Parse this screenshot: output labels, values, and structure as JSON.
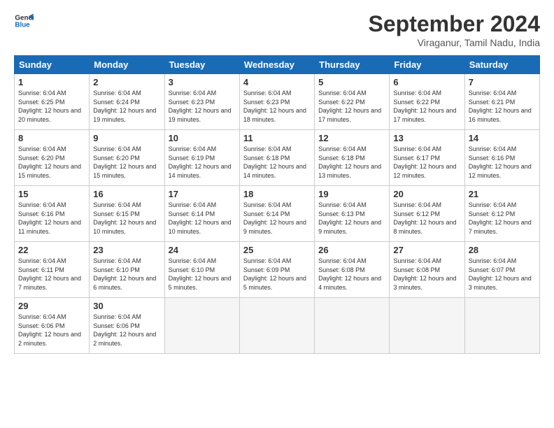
{
  "logo": {
    "line1": "General",
    "line2": "Blue"
  },
  "title": "September 2024",
  "subtitle": "Viraganur, Tamil Nadu, India",
  "days": [
    "Sunday",
    "Monday",
    "Tuesday",
    "Wednesday",
    "Thursday",
    "Friday",
    "Saturday"
  ],
  "cells": [
    {
      "day": "",
      "empty": true
    },
    {
      "day": "",
      "empty": true
    },
    {
      "day": "",
      "empty": true
    },
    {
      "day": "",
      "empty": true
    },
    {
      "day": "",
      "empty": true
    },
    {
      "day": "",
      "empty": true
    },
    {
      "day": "",
      "empty": true
    },
    {
      "num": "1",
      "rise": "6:04 AM",
      "set": "6:25 PM",
      "daylight": "12 hours and 20 minutes."
    },
    {
      "num": "2",
      "rise": "6:04 AM",
      "set": "6:24 PM",
      "daylight": "12 hours and 19 minutes."
    },
    {
      "num": "3",
      "rise": "6:04 AM",
      "set": "6:23 PM",
      "daylight": "12 hours and 19 minutes."
    },
    {
      "num": "4",
      "rise": "6:04 AM",
      "set": "6:23 PM",
      "daylight": "12 hours and 18 minutes."
    },
    {
      "num": "5",
      "rise": "6:04 AM",
      "set": "6:22 PM",
      "daylight": "12 hours and 17 minutes."
    },
    {
      "num": "6",
      "rise": "6:04 AM",
      "set": "6:22 PM",
      "daylight": "12 hours and 17 minutes."
    },
    {
      "num": "7",
      "rise": "6:04 AM",
      "set": "6:21 PM",
      "daylight": "12 hours and 16 minutes."
    },
    {
      "num": "8",
      "rise": "6:04 AM",
      "set": "6:20 PM",
      "daylight": "12 hours and 15 minutes."
    },
    {
      "num": "9",
      "rise": "6:04 AM",
      "set": "6:20 PM",
      "daylight": "12 hours and 15 minutes."
    },
    {
      "num": "10",
      "rise": "6:04 AM",
      "set": "6:19 PM",
      "daylight": "12 hours and 14 minutes."
    },
    {
      "num": "11",
      "rise": "6:04 AM",
      "set": "6:18 PM",
      "daylight": "12 hours and 14 minutes."
    },
    {
      "num": "12",
      "rise": "6:04 AM",
      "set": "6:18 PM",
      "daylight": "12 hours and 13 minutes."
    },
    {
      "num": "13",
      "rise": "6:04 AM",
      "set": "6:17 PM",
      "daylight": "12 hours and 12 minutes."
    },
    {
      "num": "14",
      "rise": "6:04 AM",
      "set": "6:16 PM",
      "daylight": "12 hours and 12 minutes."
    },
    {
      "num": "15",
      "rise": "6:04 AM",
      "set": "6:16 PM",
      "daylight": "12 hours and 11 minutes."
    },
    {
      "num": "16",
      "rise": "6:04 AM",
      "set": "6:15 PM",
      "daylight": "12 hours and 10 minutes."
    },
    {
      "num": "17",
      "rise": "6:04 AM",
      "set": "6:14 PM",
      "daylight": "12 hours and 10 minutes."
    },
    {
      "num": "18",
      "rise": "6:04 AM",
      "set": "6:14 PM",
      "daylight": "12 hours and 9 minutes."
    },
    {
      "num": "19",
      "rise": "6:04 AM",
      "set": "6:13 PM",
      "daylight": "12 hours and 9 minutes."
    },
    {
      "num": "20",
      "rise": "6:04 AM",
      "set": "6:12 PM",
      "daylight": "12 hours and 8 minutes."
    },
    {
      "num": "21",
      "rise": "6:04 AM",
      "set": "6:12 PM",
      "daylight": "12 hours and 7 minutes."
    },
    {
      "num": "22",
      "rise": "6:04 AM",
      "set": "6:11 PM",
      "daylight": "12 hours and 7 minutes."
    },
    {
      "num": "23",
      "rise": "6:04 AM",
      "set": "6:10 PM",
      "daylight": "12 hours and 6 minutes."
    },
    {
      "num": "24",
      "rise": "6:04 AM",
      "set": "6:10 PM",
      "daylight": "12 hours and 5 minutes."
    },
    {
      "num": "25",
      "rise": "6:04 AM",
      "set": "6:09 PM",
      "daylight": "12 hours and 5 minutes."
    },
    {
      "num": "26",
      "rise": "6:04 AM",
      "set": "6:08 PM",
      "daylight": "12 hours and 4 minutes."
    },
    {
      "num": "27",
      "rise": "6:04 AM",
      "set": "6:08 PM",
      "daylight": "12 hours and 3 minutes."
    },
    {
      "num": "28",
      "rise": "6:04 AM",
      "set": "6:07 PM",
      "daylight": "12 hours and 3 minutes."
    },
    {
      "num": "29",
      "rise": "6:04 AM",
      "set": "6:06 PM",
      "daylight": "12 hours and 2 minutes."
    },
    {
      "num": "30",
      "rise": "6:04 AM",
      "set": "6:06 PM",
      "daylight": "12 hours and 2 minutes."
    },
    {
      "day": "",
      "empty": true
    },
    {
      "day": "",
      "empty": true
    },
    {
      "day": "",
      "empty": true
    },
    {
      "day": "",
      "empty": true
    },
    {
      "day": "",
      "empty": true
    }
  ]
}
